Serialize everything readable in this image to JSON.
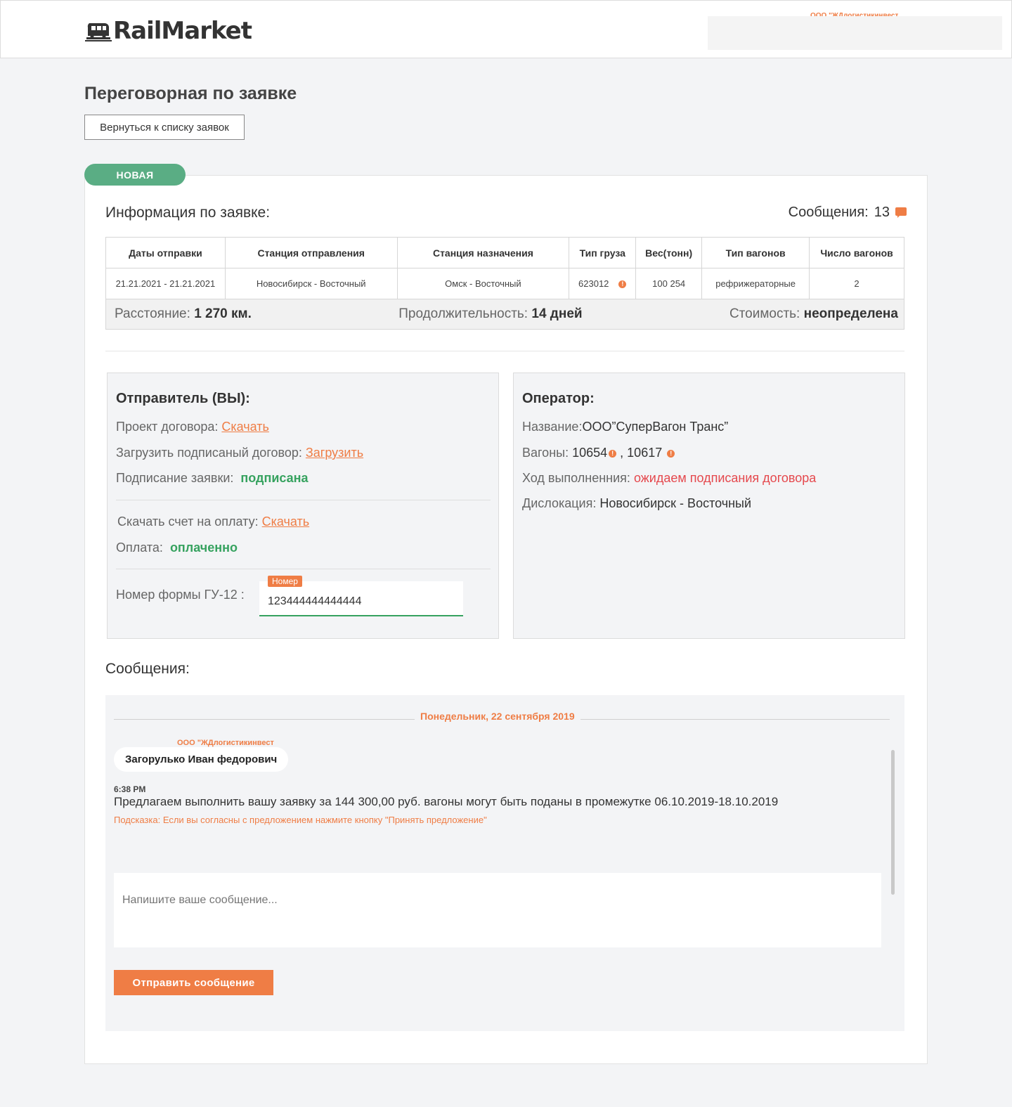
{
  "header": {
    "logo_text": "RailMarket",
    "company": "ООО \"ЖДлогистикинвест"
  },
  "page": {
    "title": "Переговорная по заявке",
    "back_label": "Вернуться к списку заявок",
    "status": "НОВАЯ"
  },
  "info": {
    "title": "Информация по заявке:",
    "messages_label": "Сообщения:",
    "messages_count": "13",
    "columns": [
      "Даты отправки",
      "Станция отправления",
      "Станция назначения",
      "Тип груза",
      "Вес(тонн)",
      "Тип вагонов",
      "Число вагонов"
    ],
    "row": [
      "21.21.2021 - 21.21.2021",
      "Новосибирск - Восточный",
      "Омск - Восточный",
      "623012",
      "100 254",
      "рефрижераторные",
      "2"
    ],
    "distance_label": "Расстояние:",
    "distance_value": "1 270 км.",
    "duration_label": "Продолжительность:",
    "duration_value": "14 дней",
    "cost_label": "Стоимость:",
    "cost_value": "неопределена"
  },
  "sender": {
    "title": "Отправитель (ВЫ):",
    "contract_label": "Проект договора:",
    "contract_link": "Скачать",
    "upload_label": "Загрузить подписаный договор:",
    "upload_link": "Загрузить",
    "sign_label": "Подписание заявки:",
    "sign_value": "подписана",
    "invoice_label": "Скачать счет на оплату:",
    "invoice_link": "Скачать",
    "payment_label": "Оплата:",
    "payment_value": "оплаченно",
    "gu12_label": "Номер формы ГУ-12 :",
    "gu12_tag": "Номер",
    "gu12_value": "123444444444444"
  },
  "operator": {
    "title": "Оператор:",
    "name_label": "Название:",
    "name_value": "ООО”СуперВагон Транс”",
    "wagons_label": "Вагоны:",
    "wagon_1": "10654",
    "wagon_sep": " , ",
    "wagon_2": "10617",
    "progress_label": "Ход выполненния:",
    "progress_value": "ожидаем подписания договора",
    "location_label": "Дислокация:",
    "location_value": "Новосибирск - Восточный"
  },
  "messages": {
    "title": "Сообщения:",
    "date": "Понедельник, 22 сентября 2019",
    "sender_company": "ООО \"ЖДлогистикинвест",
    "sender_name": "Загорулько Иван федорович",
    "time": "6:38 PM",
    "text": "Предлагаем выполнить вашу заявку за 144 300,00 руб. вагоны могут быть поданы в промежутке 06.10.2019-18.10.2019",
    "hint": "Подсказка: Если вы согласны с предложением нажмите кнопку \"Принять предложение\"",
    "input_placeholder": "Напишите ваше сообщение...",
    "send_label": "Отправить сообщение"
  },
  "colors": {
    "accent": "#ef7d45",
    "success": "#36a25f",
    "status_new": "#5aad84",
    "error": "#e5484d"
  }
}
